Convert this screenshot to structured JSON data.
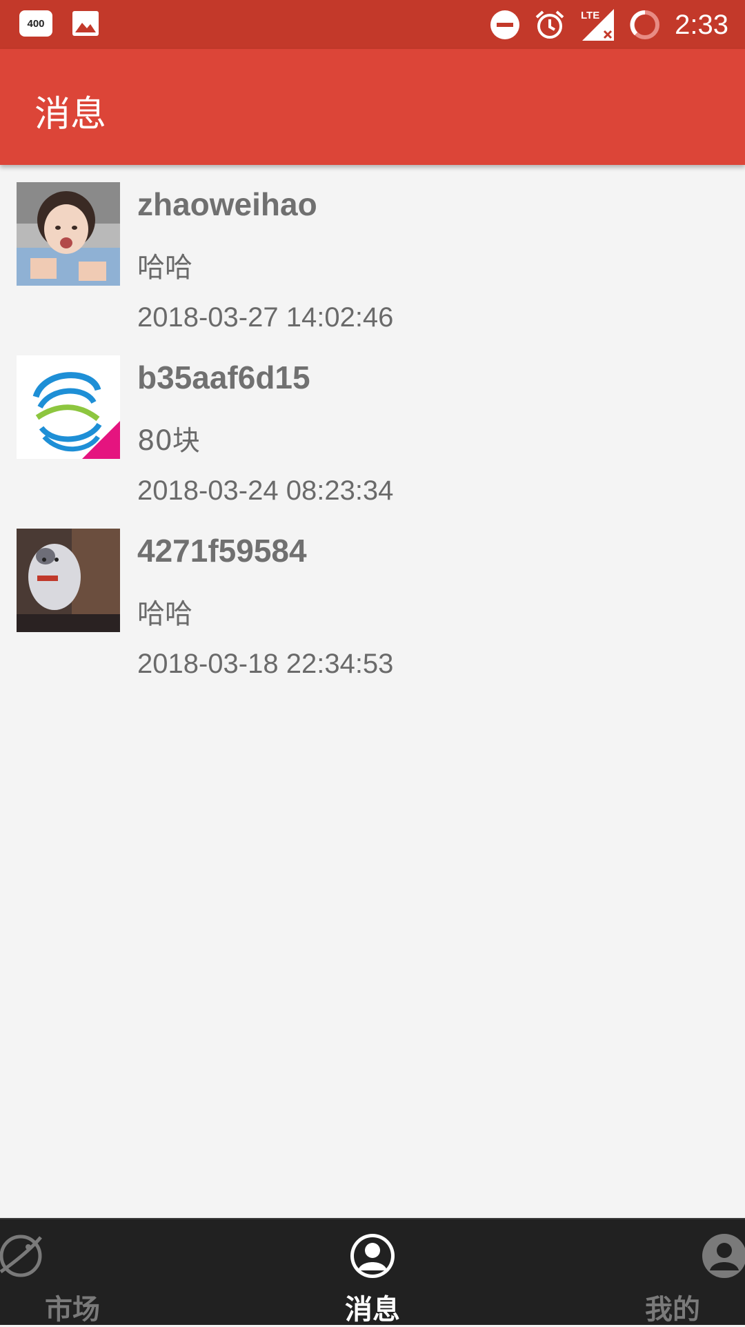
{
  "status_bar": {
    "notification_badge": "400",
    "time": "2:33",
    "network": "LTE",
    "icons": [
      "400-badge-icon",
      "image-icon",
      "dnd-icon",
      "alarm-icon",
      "lte-signal-icon",
      "battery-icon"
    ]
  },
  "header": {
    "title": "消息"
  },
  "messages": [
    {
      "name": "zhaoweihao",
      "text": "哈哈",
      "time": "2018-03-27 14:02:46"
    },
    {
      "name": "b35aaf6d15",
      "text": "80块",
      "time": "2018-03-24 08:23:34"
    },
    {
      "name": "4271f59584",
      "text": "哈哈",
      "time": "2018-03-18 22:34:53"
    }
  ],
  "bottom_nav": {
    "items": [
      {
        "label": "市场",
        "icon": "planet-icon",
        "active": false
      },
      {
        "label": "消息",
        "icon": "person-icon",
        "active": true
      },
      {
        "label": "我的",
        "icon": "person-icon",
        "active": false
      }
    ]
  },
  "colors": {
    "status_bar": "#c3392a",
    "app_bar": "#dc4538",
    "background": "#f4f4f4",
    "bottom_nav": "#212121"
  }
}
